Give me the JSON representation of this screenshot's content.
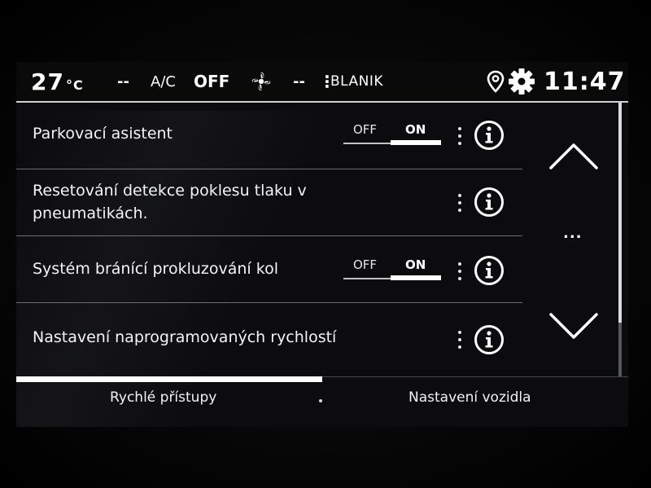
{
  "status_bar": {
    "temperature": "27",
    "temperature_unit": "°C",
    "left_value": "--",
    "ac_label": "A/C",
    "ac_state": "OFF",
    "fan_value": "--",
    "vertical_dots": "⋮",
    "blanik": "BLANIK",
    "time": "11:47"
  },
  "settings": [
    {
      "label": "Parkovací asistent",
      "has_toggle": true,
      "toggle_off": "OFF",
      "toggle_on": "ON",
      "state": "ON"
    },
    {
      "label_line1": "Resetování detekce poklesu tlaku v",
      "label_line2": "pneumatikách.",
      "has_toggle": false
    },
    {
      "label": "Systém bránící prokluzování kol",
      "has_toggle": true,
      "toggle_off": "OFF",
      "toggle_on": "ON",
      "state": "ON"
    },
    {
      "label": "Nastavení naprogramovaných rychlostí",
      "has_toggle": false
    }
  ],
  "scroll": {
    "more_indicator": "..."
  },
  "tabs": [
    {
      "label": "Rychlé přístupy",
      "active": true
    },
    {
      "label": "Nastavení vozidla",
      "active": false
    }
  ],
  "icons": {
    "fan": "fan-icon",
    "location": "location-pin-icon",
    "settings": "gear-icon",
    "info": "info-icon",
    "menu": "kebab-menu-icon",
    "up": "chevron-up-icon",
    "down": "chevron-down-icon"
  },
  "colors": {
    "background": "#0c0c0e",
    "text": "#ffffff",
    "accent": "#ffffff",
    "divider": "#6b6f75"
  }
}
